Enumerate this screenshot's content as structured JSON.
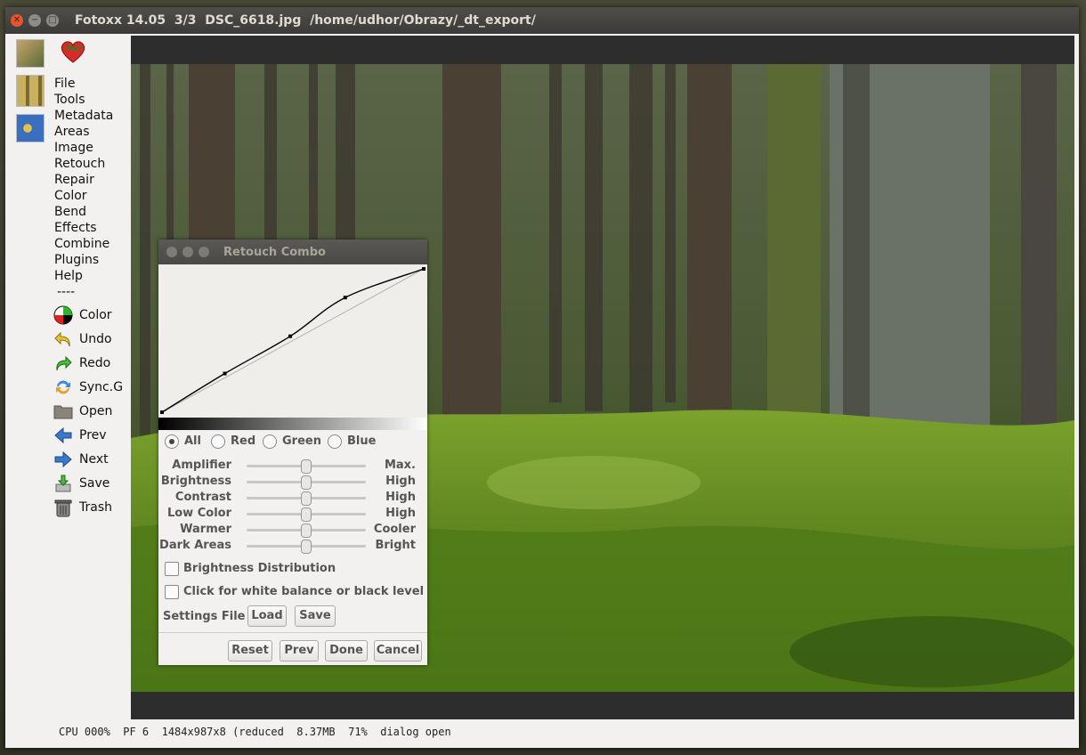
{
  "window": {
    "title": "Fotoxx 14.05  3/3  DSC_6618.jpg  /home/udhor/Obrazy/_dt_export/"
  },
  "menu": {
    "items": [
      "File",
      "Tools",
      "Metadata",
      "Areas",
      "Image",
      "Retouch",
      "Repair",
      "Color",
      "Bend",
      "Effects",
      "Combine",
      "Plugins",
      "Help",
      "----"
    ]
  },
  "tools": [
    {
      "label": "Color",
      "icon": "color-wheel-icon"
    },
    {
      "label": "Undo",
      "icon": "undo-icon"
    },
    {
      "label": "Redo",
      "icon": "redo-icon"
    },
    {
      "label": "Sync.G",
      "icon": "sync-icon"
    },
    {
      "label": "Open",
      "icon": "folder-icon"
    },
    {
      "label": "Prev",
      "icon": "arrow-left-icon"
    },
    {
      "label": "Next",
      "icon": "arrow-right-icon"
    },
    {
      "label": "Save",
      "icon": "save-icon"
    },
    {
      "label": "Trash",
      "icon": "trash-icon"
    }
  ],
  "fav_label": "Fav",
  "status": "CPU 000%  PF 6  1484x987x8 (reduced  8.37MB  71%  dialog open",
  "dialog": {
    "title": "Retouch Combo",
    "channels": [
      {
        "label": "All",
        "selected": true
      },
      {
        "label": "Red",
        "selected": false
      },
      {
        "label": "Green",
        "selected": false
      },
      {
        "label": "Blue",
        "selected": false
      }
    ],
    "sliders": [
      {
        "label": "Amplifier",
        "right": "Max.",
        "value": 0.5
      },
      {
        "label": "Brightness",
        "right": "High",
        "value": 0.5
      },
      {
        "label": "Contrast",
        "right": "High",
        "value": 0.5
      },
      {
        "label": "Low Color",
        "right": "High",
        "value": 0.5
      },
      {
        "label": "Warmer",
        "right": "Cooler",
        "value": 0.5
      },
      {
        "label": "Dark Areas",
        "right": "Bright",
        "value": 0.5
      }
    ],
    "checkbox_distribution": "Brightness Distribution",
    "checkbox_whitebalance": "Click for white balance or black level",
    "settings_file_label": "Settings File",
    "load_label": "Load",
    "save_label": "Save",
    "reset_label": "Reset",
    "prev_label": "Prev",
    "done_label": "Done",
    "cancel_label": "Cancel",
    "curve_points": [
      [
        0,
        0
      ],
      [
        0.24,
        0.27
      ],
      [
        0.49,
        0.53
      ],
      [
        0.7,
        0.8
      ],
      [
        1.0,
        1.0
      ]
    ]
  }
}
